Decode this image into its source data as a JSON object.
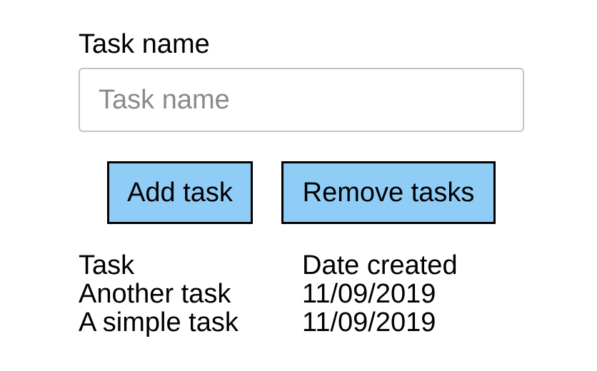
{
  "form": {
    "label": "Task name",
    "input_placeholder": "Task name",
    "input_value": ""
  },
  "buttons": {
    "add_label": "Add task",
    "remove_label": "Remove tasks"
  },
  "table": {
    "headers": [
      "Task",
      "Date created"
    ],
    "rows": [
      [
        "Another task",
        "11/09/2019"
      ],
      [
        "A simple task",
        "11/09/2019"
      ]
    ]
  },
  "colors": {
    "button_background": "#90cdf6",
    "input_border": "#c4c4c4",
    "placeholder_text": "#8a8a8a"
  }
}
